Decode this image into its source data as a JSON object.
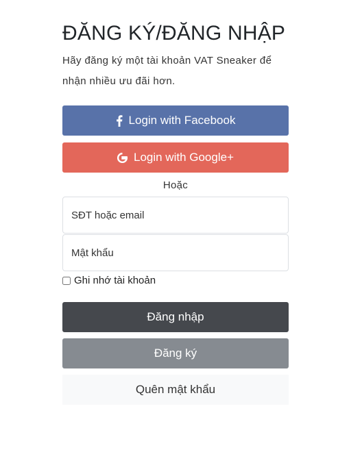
{
  "page": {
    "title": "ĐĂNG KÝ/ĐĂNG NHẬP",
    "subtitle": "Hãy đăng ký một tài khoản VAT Sneaker để nhận nhiều ưu đãi hơn."
  },
  "social": {
    "facebook_label": "Login with Facebook",
    "google_label": "Login with Google+",
    "facebook_color": "#5872a9",
    "google_color": "#e3675a"
  },
  "divider": {
    "or_label": "Hoặc"
  },
  "form": {
    "username_placeholder": "SĐT hoặc email",
    "username_value": "",
    "password_placeholder": "Mật khẩu",
    "password_value": "",
    "remember_label": "Ghi nhớ tài khoản",
    "remember_checked": false
  },
  "actions": {
    "login_label": "Đăng nhập",
    "register_label": "Đăng ký",
    "forgot_label": "Quên mật khẩu"
  },
  "icons": {
    "facebook": "facebook-icon",
    "google": "google-icon"
  }
}
